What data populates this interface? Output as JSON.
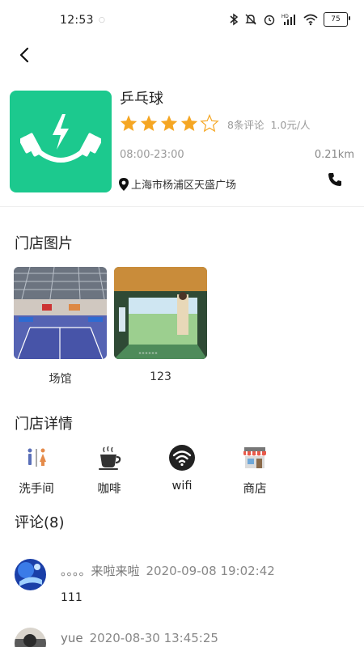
{
  "status_bar": {
    "time": "12:53",
    "dot": "○",
    "battery": "75",
    "hd_label": "HD",
    "icons": [
      "bluetooth-icon",
      "mute-icon",
      "alarm-icon",
      "signal-icon",
      "wifi-icon",
      "battery-icon"
    ]
  },
  "store": {
    "name": "乒乓球",
    "rating": 4,
    "max_rating": 5,
    "review_count": "8条评论",
    "price": "1.0元/人",
    "hours": "08:00-23:00",
    "distance": "0.21km",
    "address": "上海市杨浦区天盛广场",
    "logo_color": "#1cc98e",
    "star_color": "#f5a623"
  },
  "photos_section": {
    "title": "门店图片",
    "items": [
      {
        "caption": "场馆"
      },
      {
        "caption": "123"
      }
    ]
  },
  "details_section": {
    "title": "门店详情",
    "amenities": [
      {
        "label": "洗手间",
        "icon": "restroom-icon"
      },
      {
        "label": "咖啡",
        "icon": "coffee-icon"
      },
      {
        "label": "wifi",
        "icon": "wifi-icon"
      },
      {
        "label": "商店",
        "icon": "shop-icon"
      }
    ]
  },
  "reviews_section": {
    "title": "评论(8)",
    "items": [
      {
        "name": "。。。。来啦来啦",
        "date": "2020-09-08 19:02:42",
        "content": "111"
      },
      {
        "name": "yue",
        "date": "2020-08-30 13:45:25",
        "content": ""
      }
    ]
  }
}
